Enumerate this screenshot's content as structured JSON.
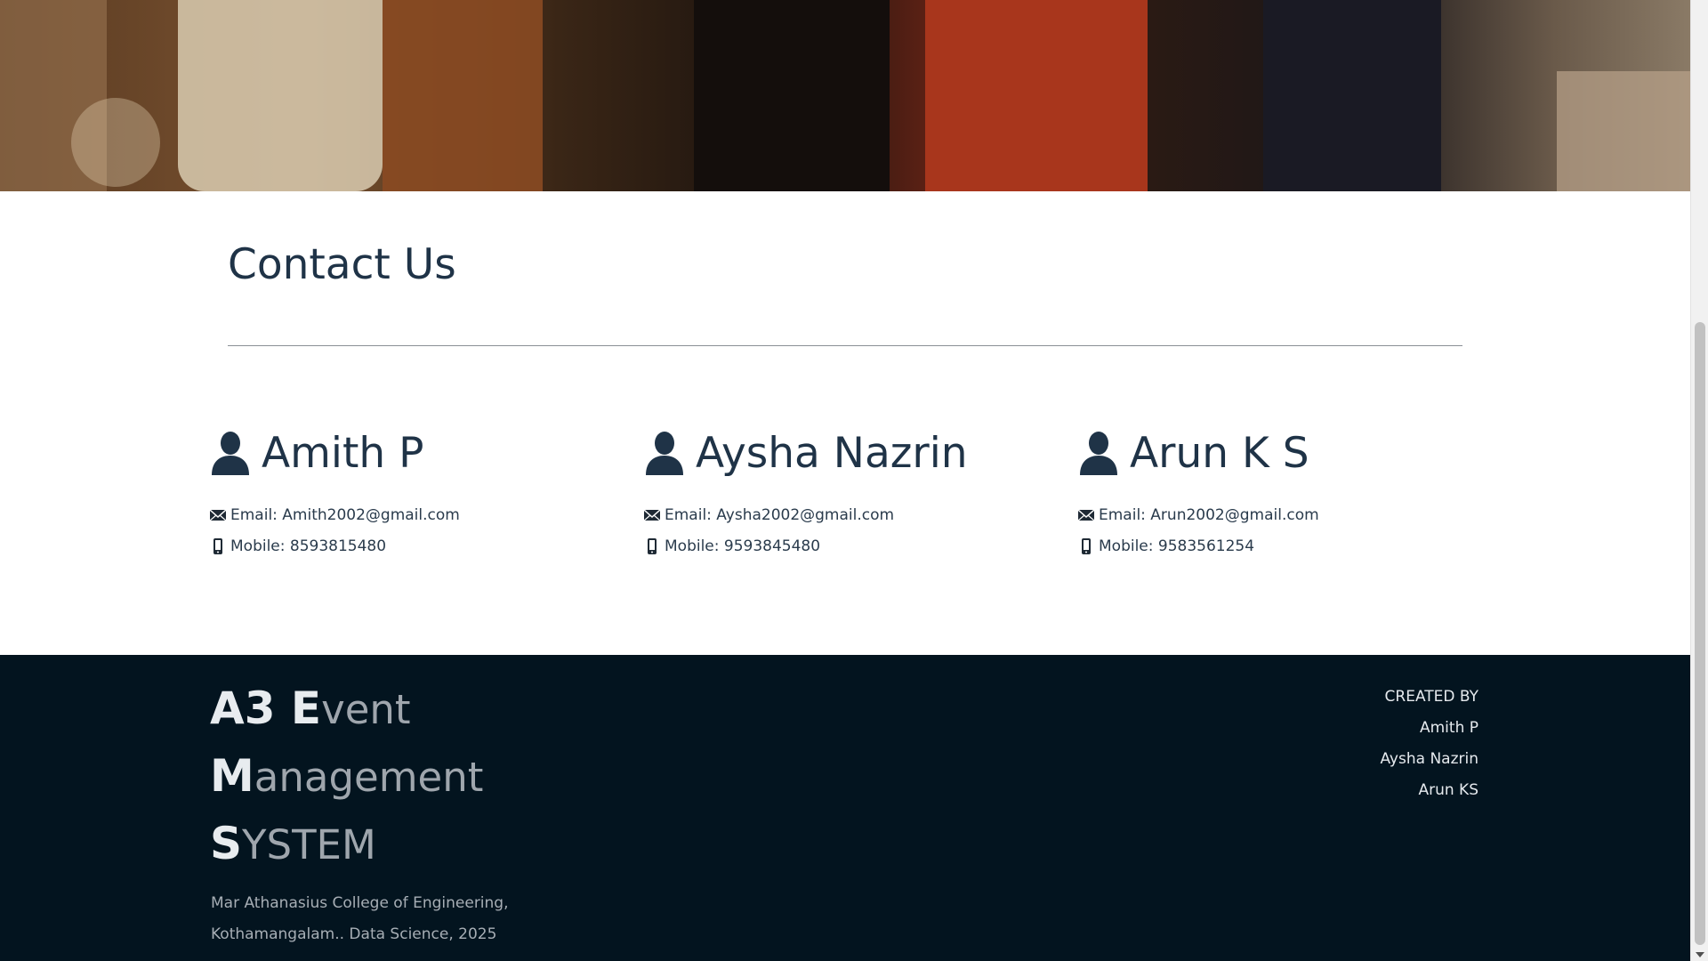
{
  "contact": {
    "title": "Contact Us",
    "people": [
      {
        "name": "Amith P",
        "email_text": "Email: Amith2002@gmail.com",
        "mobile_text": "Mobile: 8593815480"
      },
      {
        "name": "Aysha Nazrin",
        "email_text": "Email: Aysha2002@gmail.com",
        "mobile_text": "Mobile: 9593845480"
      },
      {
        "name": "Arun K S",
        "email_text": "Email: Arun2002@gmail.com",
        "mobile_text": "Mobile: 9583561254"
      }
    ]
  },
  "footer": {
    "brand": {
      "line1_big": "A3 E",
      "line1_rest": "vent",
      "line2_big": "M",
      "line2_rest": "anagement",
      "line3_big": "S",
      "line3_rest": "YSTEM"
    },
    "address_line1": "Mar Athanasius College of Engineering,",
    "address_line2": "Kothamangalam.. Data Science, 2025",
    "created_by": {
      "heading": "CREATED BY",
      "names": [
        "Amith P",
        "Aysha Nazrin",
        "Arun KS"
      ]
    }
  },
  "icons": {
    "person": "user-icon",
    "email": "envelope-icon",
    "mobile": "phone-icon"
  },
  "colors": {
    "heading": "#1f3347",
    "footer_bg": "#03141f",
    "footer_text": "#e6eaee"
  }
}
